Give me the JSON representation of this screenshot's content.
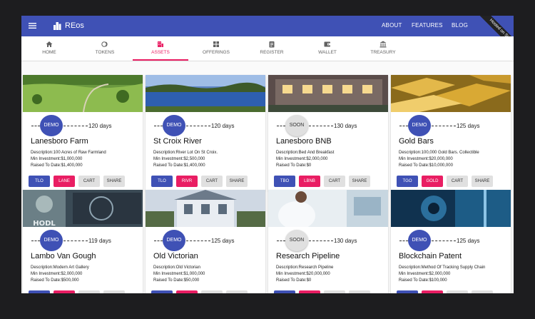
{
  "app": {
    "title": "REos"
  },
  "header": {
    "nav": [
      "ABOUT",
      "FEATURES",
      "BLOG"
    ],
    "ribbon": "Hosted on Sia"
  },
  "tabs": [
    {
      "label": "HOME",
      "icon": "home-icon"
    },
    {
      "label": "TOKENS",
      "icon": "token-icon"
    },
    {
      "label": "ASSETS",
      "icon": "assets-icon",
      "active": true
    },
    {
      "label": "OFFERINGS",
      "icon": "offerings-icon"
    },
    {
      "label": "REGISTER",
      "icon": "register-icon"
    },
    {
      "label": "WALLET",
      "icon": "wallet-icon"
    },
    {
      "label": "TREASURY",
      "icon": "treasury-icon"
    }
  ],
  "colors": {
    "primary": "#3f51b5",
    "accent": "#e91e63",
    "button_grey": "#e0e0e0"
  },
  "cards": [
    {
      "status": "DEMO",
      "days": "120 days",
      "title": "Lanesboro Farm",
      "description": "Description:100 Acres of Raw Farmland",
      "min_investment": "Min Investment:$1,000,000",
      "raised": "Raised To Date:$1,400,000",
      "token": "TLO",
      "symbol": "LANE",
      "cart": "CART",
      "share": "SHARE",
      "image": "farmland"
    },
    {
      "status": "DEMO",
      "days": "120 days",
      "title": "St Croix River",
      "description": "Description:River Lot On St Croix.",
      "min_investment": "Min Investment:$2,500,000",
      "raised": "Raised To Date:$1,400,000",
      "token": "TLO",
      "symbol": "RIVR",
      "cart": "CART",
      "share": "SHARE",
      "image": "river"
    },
    {
      "status": "SOON",
      "days": "130 days",
      "title": "Lanesboro BNB",
      "description": "Description:Bed And Breakfast",
      "min_investment": "Min Investment:$2,000,000",
      "raised": "Raised To Date:$0",
      "token": "TBO",
      "symbol": "LBNB",
      "cart": "CART",
      "share": "SHARE",
      "image": "house"
    },
    {
      "status": "DEMO",
      "days": "125 days",
      "title": "Gold Bars",
      "description": "Description:100,000 Gold Bars. Collectible",
      "min_investment": "Min Investment:$20,000,000",
      "raised": "Raised To Date:$10,000,000",
      "token": "TGO",
      "symbol": "GOLD",
      "cart": "CART",
      "share": "SHARE",
      "image": "gold"
    },
    {
      "status": "DEMO",
      "days": "119 days",
      "title": "Lambo Van Gough",
      "description": "Description:Modern Art Gallery",
      "min_investment": "Min Investment:$2,000,000",
      "raised": "Raised To Date:$500,000",
      "image": "art",
      "image_text": "HODL"
    },
    {
      "status": "DEMO",
      "days": "125 days",
      "title": "Old Victorian",
      "description": "Description:Old Victorian",
      "min_investment": "Min Investment:$1,000,000",
      "raised": "Raised To Date:$50,000",
      "image": "victorian"
    },
    {
      "status": "SOON",
      "days": "130 days",
      "title": "Research Pipeline",
      "description": "Description:Research Pipeline",
      "min_investment": "Min Investment:$20,000,000",
      "raised": "Raised To Date:$0",
      "image": "lab"
    },
    {
      "status": "DEMO",
      "days": "125 days",
      "title": "Blockchain Patent",
      "description": "Description:Method Of Tracking Supply Chain",
      "min_investment": "Min Investment:$2,000,000",
      "raised": "Raised To Date:$100,000",
      "image": "vault"
    }
  ]
}
